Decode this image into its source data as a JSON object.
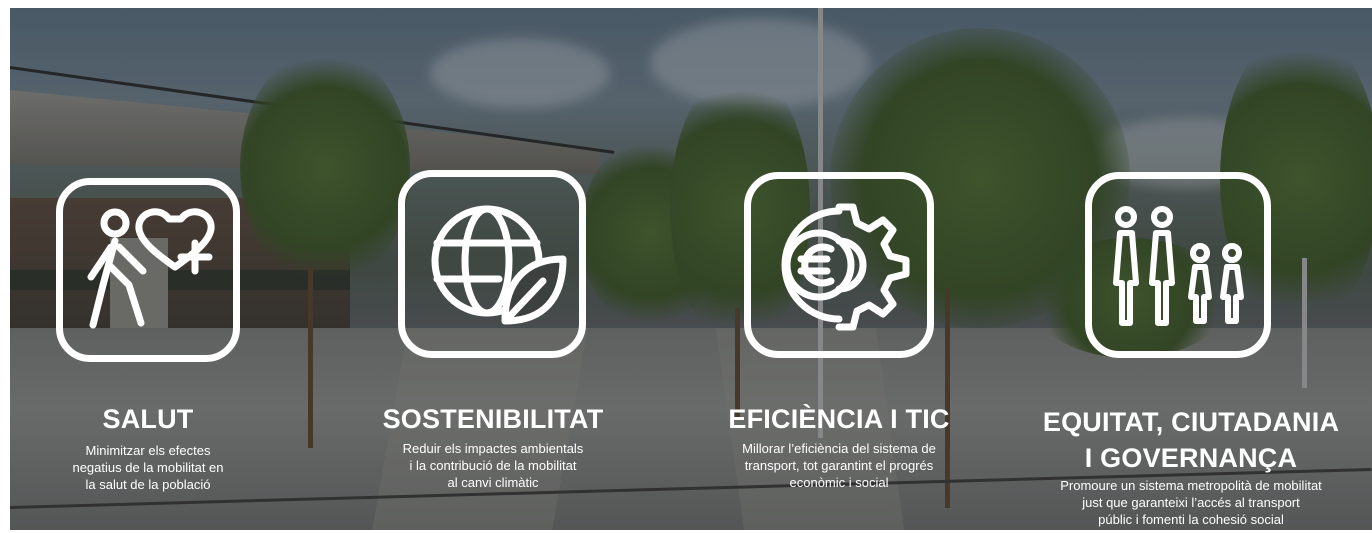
{
  "pillars": [
    {
      "title": "SALUT",
      "description_lines": [
        "Minimitzar els efectes",
        "negatius de la mobilitat en",
        "la salut de la població"
      ],
      "icon": "person-heart-icon"
    },
    {
      "title": "SOSTENIBILITAT",
      "description_lines": [
        "Reduir els impactes ambientals",
        "i la contribució de la mobilitat",
        "al canvi climàtic"
      ],
      "icon": "globe-leaf-icon"
    },
    {
      "title": "EFICIÈNCIA I TIC",
      "description_lines": [
        "Millorar l’eficiència del sistema de",
        "transport, tot garantint el progrés",
        "econòmic i social"
      ],
      "icon": "euro-gear-icon"
    },
    {
      "title_lines": [
        "EQUITAT, CIUTADANIA",
        "I GOVERNANÇA"
      ],
      "description_lines": [
        "Promoure un sistema metropolità de mobilitat",
        "just que garanteixi l’accés al transport",
        "públic i fomenti la cohesió social"
      ],
      "icon": "family-icon"
    }
  ],
  "colors": {
    "overlay_text": "#ffffff"
  }
}
